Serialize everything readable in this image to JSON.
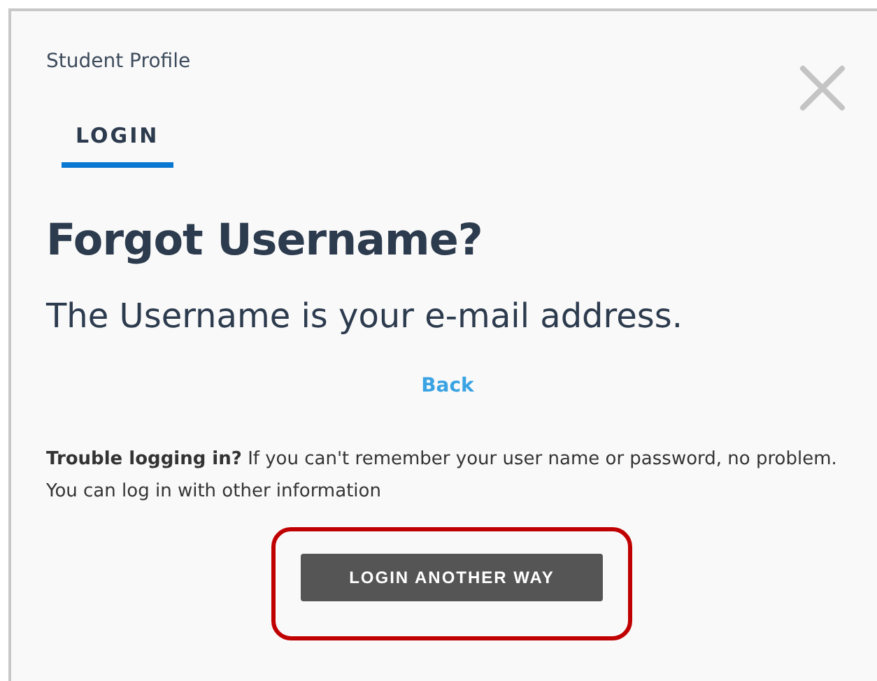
{
  "panel": {
    "title": "Student Profile"
  },
  "tabs": [
    {
      "label": "LOGIN",
      "selected": true
    }
  ],
  "heading": "Forgot Username?",
  "subheading": "The Username is your e-mail address.",
  "back_link": "Back",
  "help_text": "**Trouble logging in?** If you can't remember your user name or password, no problem. You can log in with other information",
  "action_button": {
    "label": "LOGIN ANOTHER WAY",
    "highlighted": true
  }
}
